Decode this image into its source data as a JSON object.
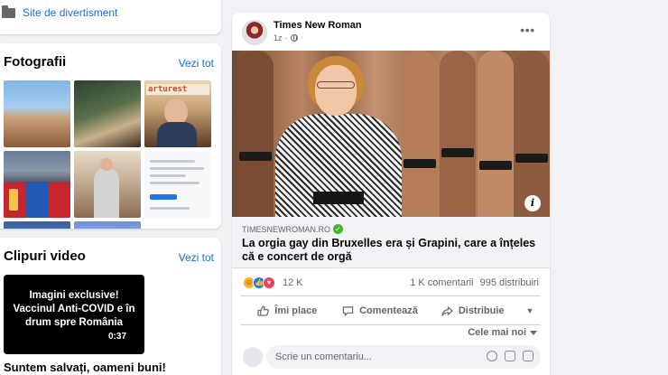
{
  "left_top": {
    "site_label": "Site de divertisment"
  },
  "photos": {
    "title": "Fotografii",
    "see_all": "Vezi tot",
    "banner_text": "arturest"
  },
  "videos": {
    "title": "Clipuri video",
    "see_all": "Vezi tot",
    "thumb_text": "Imagini exclusive! Vaccinul Anti-COVID e în drum spre România",
    "duration": "0:37",
    "caption": "Suntem salvați, oameni buni!"
  },
  "post": {
    "author": "Times New Roman",
    "time": "1z",
    "link": {
      "domain": "TIMESNEWROMAN.RO",
      "headline": "La orgia gay din Bruxelles era și Grapini, care a înțeles că e concert de orgă"
    },
    "reaction_count": "12 K",
    "comments": "1 K comentarii",
    "shares": "995 distribuiri",
    "actions": {
      "like": "Îmi place",
      "comment": "Comentează",
      "share": "Distribuie"
    },
    "sort_label": "Cele mai noi",
    "comment_placeholder": "Scrie un comentariu..."
  },
  "colors": {
    "link_blue": "#216fdb",
    "fb_blue": "#1877f2",
    "verified_green": "#42b72a",
    "background": "#f0f2f5"
  }
}
